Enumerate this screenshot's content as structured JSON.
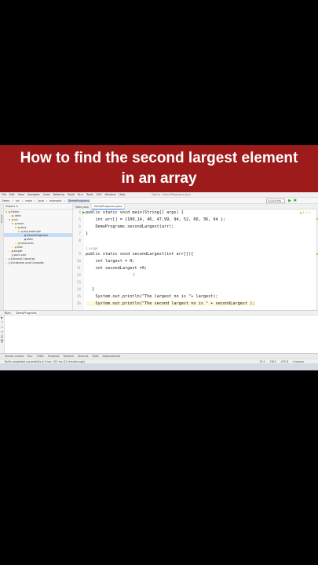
{
  "banner": {
    "line1": "How to find the second largest element",
    "line2": "in an array",
    "color": "#9e1b1b"
  },
  "menu": [
    "File",
    "Edit",
    "View",
    "Navigate",
    "Code",
    "Refactor",
    "Build",
    "Run",
    "Tools",
    "VCS",
    "Window",
    "Help",
    "Demo - DemoPrograms.java"
  ],
  "nav": {
    "crumbs": [
      "Demo",
      "src",
      "main",
      "java",
      "example",
      "DemoPrograms"
    ],
    "run_config": "Current File"
  },
  "project_panel": {
    "title": "Project",
    "items": [
      {
        "icon": "folder-icon",
        "label": "Demo"
      },
      {
        "icon": "folder-icon",
        "label": ".idea"
      },
      {
        "icon": "folder-icon",
        "label": "src"
      },
      {
        "icon": "folder-icon",
        "label": "main"
      },
      {
        "icon": "folder-icon",
        "label": "java"
      },
      {
        "icon": "folder-icon",
        "label": "org.example"
      },
      {
        "icon": "java-icon",
        "label": "DemoPrograms"
      },
      {
        "icon": "java-icon",
        "label": "Main"
      },
      {
        "icon": "folder-icon",
        "label": "resources"
      },
      {
        "icon": "folder-icon",
        "label": "test"
      },
      {
        "icon": "folder-icon",
        "label": "target"
      },
      {
        "icon": "file-icon",
        "label": "pom.xml"
      },
      {
        "icon": "lib-icon",
        "label": "External Libraries"
      },
      {
        "icon": "lib-icon",
        "label": "Scratches and Consoles"
      }
    ]
  },
  "editor": {
    "tabs": [
      "Main.java",
      "DemoPrograms.java"
    ],
    "warnings": "▲ 1  ✓ 1",
    "line_numbers": [
      "4",
      "5",
      "6",
      "7",
      "8",
      "9",
      "10",
      "11",
      "12",
      "13",
      "14",
      "15",
      "16"
    ],
    "usage_hint": "1 usage",
    "lines": [
      "public static void main(String[] args) {",
      "    int arr[] = {100,14, 46, 47,99, 94, 52, 66, 36, 94 };",
      "    DemoPrograms.secondLargest(arr);",
      "}",
      "",
      "public static void secondLargest(int arr[]){",
      "    int largest = 0;",
      "    int secondLargest =0;",
      "",
      "",
      "}",
      "    System.out.println(\"The largest no is \"+ largest);",
      "    System.out.println(\"The second largest no is \" + secondLargest );"
    ]
  },
  "run_panel": {
    "tabs": [
      "Run:",
      "DemoPrograms"
    ],
    "tools": [
      "▶",
      "↑",
      "↓",
      "≡",
      "⎙",
      "🗑"
    ]
  },
  "bottom_toolbar": [
    "Version Control",
    "Run",
    "TODO",
    "Problems",
    "Terminal",
    "Services",
    "Build",
    "Dependencies"
  ],
  "status": {
    "message": "Build completed successfully in 3 sec, 512 ms (12 minutes ago)",
    "position": "15:1",
    "line_sep": "CRLF",
    "encoding": "UTF-8",
    "indent": "4 spaces"
  }
}
